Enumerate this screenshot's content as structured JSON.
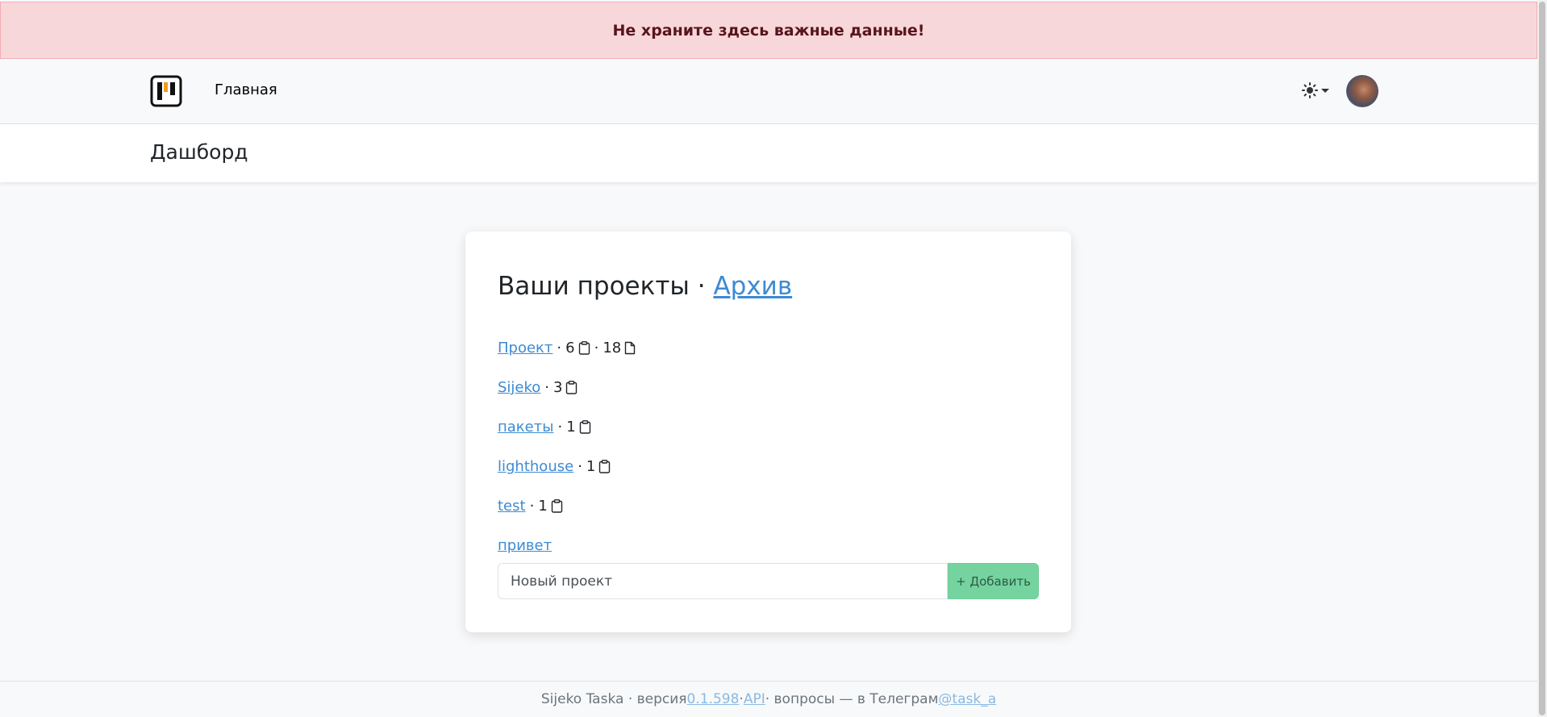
{
  "alert": {
    "text": "Не храните здесь важные данные!",
    "color": "#f8d7da"
  },
  "navbar": {
    "logo_icon": "kanban-board-icon",
    "home_label": "Главная",
    "theme_icon": "sun-icon"
  },
  "header": {
    "title": "Дашборд"
  },
  "projects": {
    "title": "Ваши проекты",
    "title_sep": " · ",
    "archive_label": "Архив",
    "items": [
      {
        "name": "Проект",
        "boards": "6",
        "tasks": "18"
      },
      {
        "name": "Sijeko",
        "boards": "3",
        "tasks": null
      },
      {
        "name": "пакеты",
        "boards": "1",
        "tasks": null
      },
      {
        "name": "lighthouse",
        "boards": "1",
        "tasks": null
      },
      {
        "name": "test",
        "boards": "1",
        "tasks": null
      },
      {
        "name": "привет",
        "boards": null,
        "tasks": null
      }
    ],
    "input_placeholder": "Новый проект",
    "add_label": "+ Добавить"
  },
  "footer": {
    "prefix": "Sijeko Taska · версия ",
    "version": "0.1.598",
    "mid": " · ",
    "api": "API",
    "suffix": " · вопросы — в Телеграм ",
    "telegram": "@task_a"
  }
}
